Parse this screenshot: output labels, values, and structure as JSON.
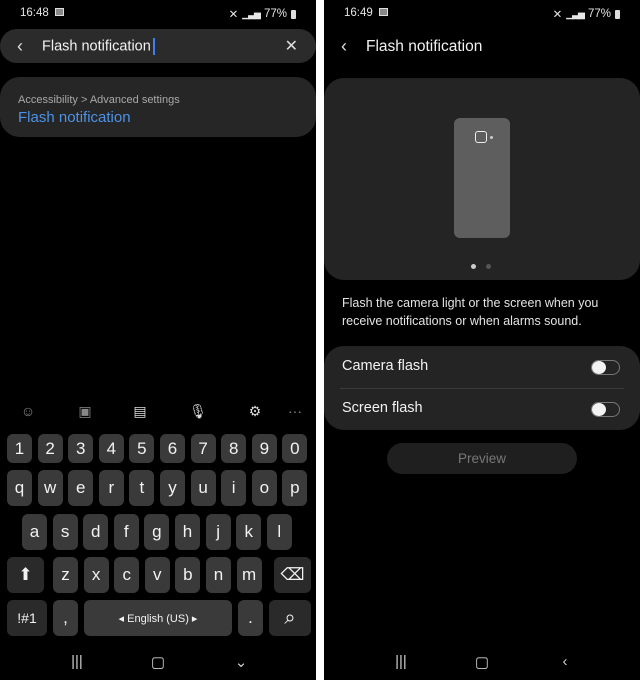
{
  "left": {
    "status": {
      "time": "16:48",
      "battery": "77%"
    },
    "search": {
      "value": "Flash notification"
    },
    "result": {
      "breadcrumb": "Accessibility > Advanced settings",
      "title": "Flash notification"
    },
    "toolbar": [
      "emoji-icon",
      "sticker-icon",
      "clipboard-icon",
      "mic-icon",
      "gear-icon",
      "more-icon"
    ],
    "keyboard": {
      "row_numbers": [
        "1",
        "2",
        "3",
        "4",
        "5",
        "6",
        "7",
        "8",
        "9",
        "0"
      ],
      "row1": [
        "q",
        "w",
        "e",
        "r",
        "t",
        "y",
        "u",
        "i",
        "o",
        "p"
      ],
      "row2": [
        "a",
        "s",
        "d",
        "f",
        "g",
        "h",
        "j",
        "k",
        "l"
      ],
      "row3": [
        "z",
        "x",
        "c",
        "v",
        "b",
        "n",
        "m"
      ],
      "symbols": "!#1",
      "comma": ",",
      "space": "◂ English (US) ▸",
      "period": "."
    }
  },
  "right": {
    "status": {
      "time": "16:49",
      "battery": "77%"
    },
    "title": "Flash notification",
    "page_indicator": {
      "current": 1,
      "total": 2
    },
    "description": "Flash the camera light or the screen when you receive notifications or when alarms sound.",
    "toggles": [
      {
        "label": "Camera flash",
        "on": false
      },
      {
        "label": "Screen flash",
        "on": false
      }
    ],
    "preview_button": "Preview"
  }
}
